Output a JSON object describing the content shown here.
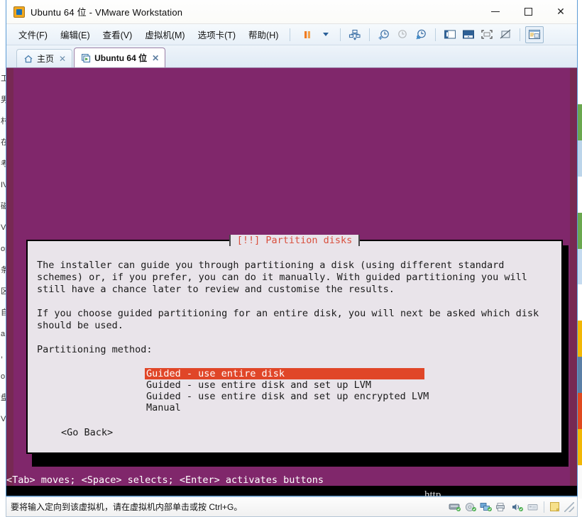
{
  "window": {
    "title": "Ubuntu 64 位 - VMware Workstation",
    "app_icon": "vmware-icon",
    "minimize_label": "最小化",
    "maximize_label": "最大化",
    "close_label": "关闭"
  },
  "menu": {
    "items": [
      {
        "label": "文件(F)",
        "name": "menu-file"
      },
      {
        "label": "编辑(E)",
        "name": "menu-edit"
      },
      {
        "label": "查看(V)",
        "name": "menu-view"
      },
      {
        "label": "虚拟机(M)",
        "name": "menu-vm"
      },
      {
        "label": "选项卡(T)",
        "name": "menu-tabs"
      },
      {
        "label": "帮助(H)",
        "name": "menu-help"
      }
    ]
  },
  "toolbar": {
    "buttons": [
      {
        "name": "suspend-button",
        "icon": "pause-icon"
      },
      {
        "name": "power-dropdown-button",
        "icon": "chevron-down-icon"
      },
      {
        "name": "manage-snapshots-button",
        "icon": "snapshot-manager-icon"
      },
      {
        "name": "take-snapshot-button",
        "icon": "snapshot-add-icon"
      },
      {
        "name": "revert-snapshot-button",
        "icon": "snapshot-revert-icon"
      },
      {
        "name": "snapshot-manager-button",
        "icon": "snapshot-settings-icon"
      },
      {
        "name": "show-library-button",
        "icon": "sidebar-panel-icon"
      },
      {
        "name": "show-thumbnail-bar-button",
        "icon": "thumbnail-bar-icon"
      },
      {
        "name": "fullscreen-button",
        "icon": "fullscreen-icon"
      },
      {
        "name": "unity-mode-button",
        "icon": "unity-mode-icon"
      },
      {
        "name": "console-view-button",
        "icon": "console-view-icon"
      }
    ]
  },
  "tabs": [
    {
      "label": "主页",
      "icon": "home-icon",
      "active": false,
      "name": "tab-home"
    },
    {
      "label": "Ubuntu 64 位",
      "icon": "vm-icon",
      "active": true,
      "name": "tab-ubuntu-64"
    }
  ],
  "vm": {
    "background_color": "#772953",
    "hint_line": "<Tab> moves; <Space> selects; <Enter> activates buttons",
    "dialog": {
      "title": "[!!] Partition disks",
      "title_color": "#d94f3d",
      "paragraphs": [
        "The installer can guide you through partitioning a disk (using different standard\nschemes) or, if you prefer, you can do it manually. With guided partitioning you will\nstill have a chance later to review and customise the results.",
        "If you choose guided partitioning for an entire disk, you will next be asked which disk\nshould be used.",
        "Partitioning method:"
      ],
      "options": [
        {
          "label": "Guided - use entire disk",
          "selected": true
        },
        {
          "label": "Guided - use entire disk and set up LVM",
          "selected": false
        },
        {
          "label": "Guided - use entire disk and set up encrypted LVM",
          "selected": false
        },
        {
          "label": "Manual",
          "selected": false
        }
      ],
      "selection_color": "#e04628",
      "go_back_label": "<Go Back>"
    }
  },
  "status_bar": {
    "message": "要将输入定向到该虚拟机，请在虚拟机内部单击或按 Ctrl+G。",
    "devices": [
      {
        "name": "hard-disk-icon",
        "glyph": "▤"
      },
      {
        "name": "cd-dvd-icon",
        "glyph": "◉"
      },
      {
        "name": "network-adapter-icon",
        "glyph": "⧉"
      },
      {
        "name": "printer-icon",
        "glyph": "⎙"
      },
      {
        "name": "sound-card-icon",
        "glyph": "♪"
      },
      {
        "name": "usb-device-icon",
        "glyph": "⌸"
      },
      {
        "name": "notes-icon",
        "glyph": "▭"
      }
    ]
  },
  "backdrop": {
    "left_strip_chars": [
      "工",
      "男",
      "村",
      "在",
      "考",
      "IV",
      "磁",
      "VM",
      "op",
      "条",
      "区",
      "自",
      "a",
      ",",
      "o",
      "盘",
      "VM"
    ],
    "right_strip_colors": [
      "#ffffff",
      "#6aa84f",
      "#bcd5ea",
      "#ffffff",
      "#6aa84f",
      "#c5dbf0",
      "#ffffff",
      "#f2b705",
      "#5b7fa6",
      "#e04a1f",
      "#f2b705"
    ],
    "ghost_text": "http"
  }
}
